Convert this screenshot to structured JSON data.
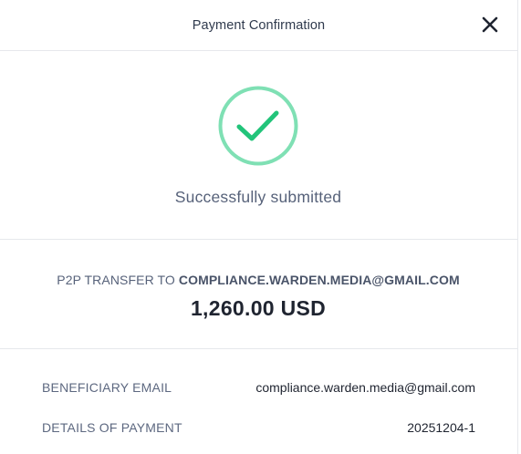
{
  "header": {
    "title": "Payment Confirmation",
    "close_icon": "close-icon"
  },
  "status": {
    "icon": "checkmark-circle-icon",
    "message": "Successfully submitted",
    "colors": {
      "ring": "#7fe0b4",
      "check": "#22c47a"
    }
  },
  "transfer": {
    "prefix": "P2P TRANSFER TO ",
    "recipient": "COMPLIANCE.WARDEN.MEDIA@GMAIL.COM",
    "amount": "1,260.00 USD"
  },
  "details": [
    {
      "label": "BENEFICIARY EMAIL",
      "value": "compliance.warden.media@gmail.com"
    },
    {
      "label": "DETAILS OF PAYMENT",
      "value": "20251204-1"
    }
  ]
}
